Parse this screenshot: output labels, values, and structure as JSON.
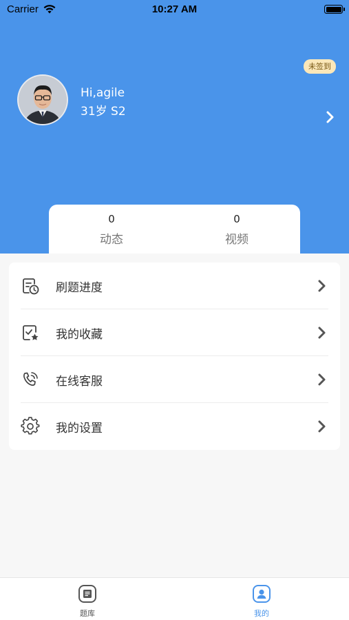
{
  "status_bar": {
    "carrier": "Carrier",
    "time": "10:27 AM"
  },
  "profile": {
    "sign_badge": "未签到",
    "greeting": "Hi,agile",
    "meta": "31岁 S2"
  },
  "stats": [
    {
      "value": "0",
      "label": "动态"
    },
    {
      "value": "0",
      "label": "视频"
    }
  ],
  "menu": [
    {
      "label": "刷题进度",
      "icon": "progress-clock-icon"
    },
    {
      "label": "我的收藏",
      "icon": "favorite-star-icon"
    },
    {
      "label": "在线客服",
      "icon": "phone-call-icon"
    },
    {
      "label": "我的设置",
      "icon": "gear-icon"
    }
  ],
  "tabs": [
    {
      "label": "题库",
      "icon": "question-bank-icon",
      "active": false
    },
    {
      "label": "我的",
      "icon": "profile-icon",
      "active": true
    }
  ],
  "colors": {
    "primary": "#4a94ea",
    "badge_bg": "#fbe7b9",
    "background": "#f7f7f7"
  }
}
